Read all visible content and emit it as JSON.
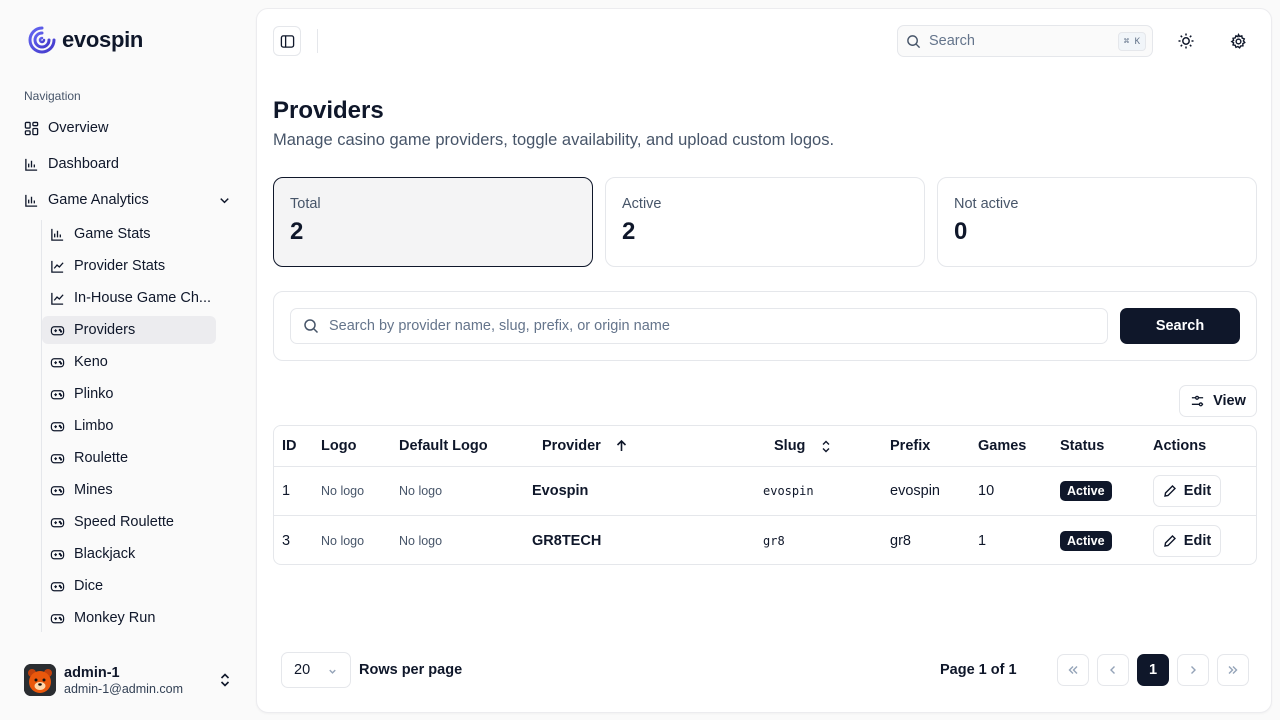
{
  "brand": {
    "name": "evospin"
  },
  "sidebar": {
    "heading": "Navigation",
    "items": [
      {
        "label": "Overview",
        "icon": "grid-icon"
      },
      {
        "label": "Dashboard",
        "icon": "bar-chart-icon"
      },
      {
        "label": "Game Analytics",
        "icon": "bar-chart-icon",
        "expanded": true
      }
    ],
    "sub_items": [
      {
        "label": "Game Stats",
        "icon": "bar-chart-icon"
      },
      {
        "label": "Provider Stats",
        "icon": "line-chart-icon"
      },
      {
        "label": "In-House Game Ch...",
        "icon": "line-chart-icon"
      },
      {
        "label": "Providers",
        "icon": "gamepad-icon",
        "active": true
      },
      {
        "label": "Keno",
        "icon": "gamepad-icon"
      },
      {
        "label": "Plinko",
        "icon": "gamepad-icon"
      },
      {
        "label": "Limbo",
        "icon": "gamepad-icon"
      },
      {
        "label": "Roulette",
        "icon": "gamepad-icon"
      },
      {
        "label": "Mines",
        "icon": "gamepad-icon"
      },
      {
        "label": "Speed Roulette",
        "icon": "gamepad-icon"
      },
      {
        "label": "Blackjack",
        "icon": "gamepad-icon"
      },
      {
        "label": "Dice",
        "icon": "gamepad-icon"
      },
      {
        "label": "Monkey Run",
        "icon": "gamepad-icon"
      }
    ],
    "user": {
      "name": "admin-1",
      "email": "admin-1@admin.com"
    }
  },
  "topbar": {
    "search_placeholder": "Search",
    "shortcut": "⌘ K"
  },
  "page": {
    "title": "Providers",
    "subtitle": "Manage casino game providers, toggle availability, and upload custom logos."
  },
  "stats": [
    {
      "label": "Total",
      "value": "2"
    },
    {
      "label": "Active",
      "value": "2"
    },
    {
      "label": "Not active",
      "value": "0"
    }
  ],
  "filter": {
    "placeholder": "Search by provider name, slug, prefix, or origin name",
    "button": "Search",
    "view_button": "View"
  },
  "table": {
    "columns": [
      "ID",
      "Logo",
      "Default Logo",
      "Provider",
      "Slug",
      "Prefix",
      "Games",
      "Status",
      "Actions"
    ],
    "rows": [
      {
        "id": "1",
        "logo": "No logo",
        "default_logo": "No logo",
        "provider": "Evospin",
        "slug": "evospin",
        "prefix": "evospin",
        "games": "10",
        "status": "Active",
        "action": "Edit"
      },
      {
        "id": "3",
        "logo": "No logo",
        "default_logo": "No logo",
        "provider": "GR8TECH",
        "slug": "gr8",
        "prefix": "gr8",
        "games": "1",
        "status": "Active",
        "action": "Edit"
      }
    ]
  },
  "pagination": {
    "rows_per_page": "20",
    "rows_per_page_label": "Rows per page",
    "page_info": "Page 1 of 1",
    "current_page": "1"
  },
  "colors": {
    "primary": "#0f172a",
    "brand": "#4f46e5",
    "muted": "#475569",
    "border": "#e5e7eb"
  }
}
